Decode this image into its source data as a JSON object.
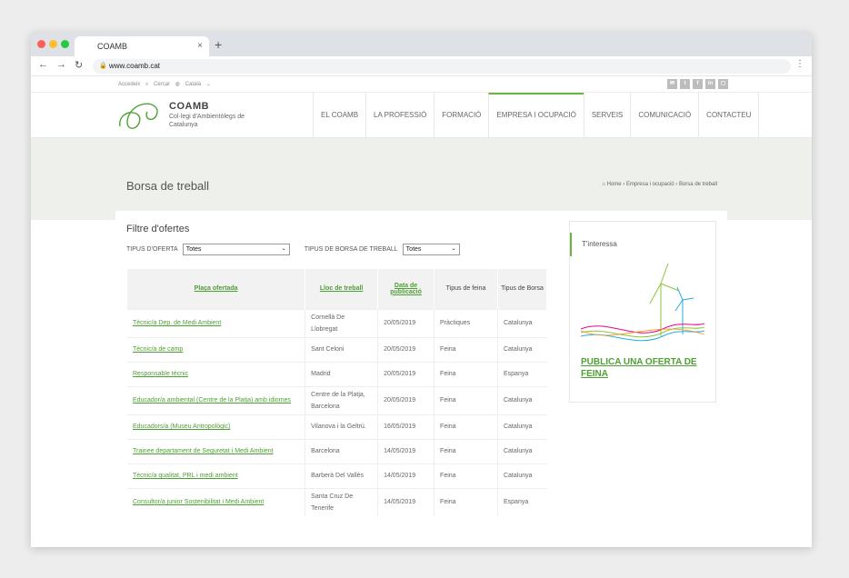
{
  "browser": {
    "tab_title": "COAMB",
    "tab_close": "×",
    "new_tab": "+",
    "url": "www.coamb.cat"
  },
  "utility": {
    "accessibility": "Accedeix",
    "search": "Cercar",
    "language": "Català"
  },
  "header": {
    "logo_title": "COAMB",
    "logo_subtitle": "Col·legi d'Ambientòlegs de Catalunya",
    "nav": [
      {
        "label": "El COAMB"
      },
      {
        "label": "La professió"
      },
      {
        "label": "Formació"
      },
      {
        "label": "Empresa i ocupació"
      },
      {
        "label": "Serveis"
      },
      {
        "label": "Comunicació"
      },
      {
        "label": "Contacteu"
      }
    ]
  },
  "hero": {
    "title": "Borsa de treball",
    "breadcrumb": "Home › Empresa i ocupació › Borsa de treball"
  },
  "filters": {
    "title": "Filtre d'ofertes",
    "offer_type_label": "TIPUS D'OFERTA",
    "offer_type_value": "Totes",
    "board_type_label": "TIPUS DE BORSA DE TREBALL",
    "board_type_value": "Totes"
  },
  "table": {
    "headers": [
      "Plaça ofertada",
      "Lloc de treball",
      "Data de publicació",
      "Tipus de feina",
      "Tipus de Borsa"
    ],
    "rows": [
      {
        "title": "Tècnic/a Dep. de Medi Ambient",
        "location": "Cornellà De Llobregat",
        "date": "20/05/2019",
        "type": "Pràctiques",
        "board": "Catalunya"
      },
      {
        "title": "Tècnic/a de camp",
        "location": "Sant Celoni",
        "date": "20/05/2019",
        "type": "Feina",
        "board": "Catalunya"
      },
      {
        "title": "Responsable tècnic",
        "location": "Madrid",
        "date": "20/05/2019",
        "type": "Feina",
        "board": "Espanya"
      },
      {
        "title": "Educador/a ambiental (Centre de la Platja) amb idiomes",
        "location": "Centre de la Platja, Barcelona",
        "date": "20/05/2019",
        "type": "Feina",
        "board": "Catalunya"
      },
      {
        "title": "Educadors/a (Museu Antropològic)",
        "location": "Vilanova i la Geltrú.",
        "date": "16/05/2019",
        "type": "Feina",
        "board": "Catalunya"
      },
      {
        "title": "Trainee departament de Seguretat i Medi Ambient",
        "location": "Barcelona",
        "date": "14/05/2019",
        "type": "Feina",
        "board": "Catalunya"
      },
      {
        "title": "Tècnic/a qualitat, PRL i medi ambient",
        "location": "Barberà Del Vallès",
        "date": "14/05/2019",
        "type": "Feina",
        "board": "Catalunya"
      },
      {
        "title": "Consultor/a junior Sostenibilitat i Medi Ambient",
        "location": "Santa Cruz De Tenerife",
        "date": "14/05/2019",
        "type": "Feina",
        "board": "Espanya"
      }
    ]
  },
  "sidebar": {
    "heading": "T'interessa",
    "cta": "PUBLICA UNA OFERTA DE FEINA"
  }
}
